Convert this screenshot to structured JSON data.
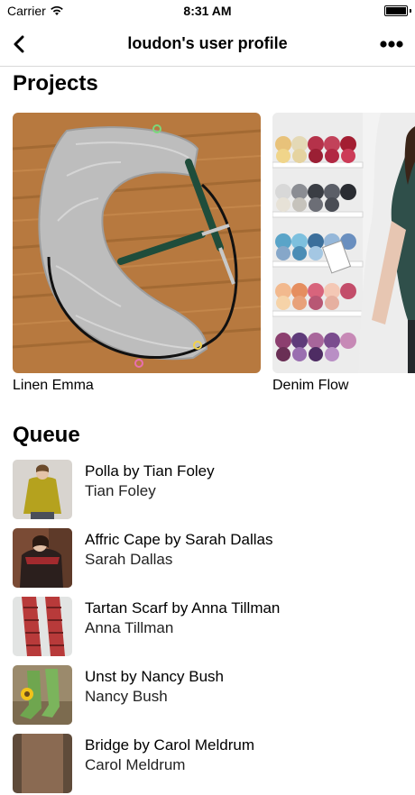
{
  "status": {
    "carrier": "Carrier",
    "time": "8:31 AM"
  },
  "nav": {
    "title": "loudon's user profile",
    "back_icon": "chevron-left-icon",
    "more_icon": "ellipsis-icon"
  },
  "projects": {
    "heading": "Projects",
    "items": [
      {
        "name": "Linen Emma"
      },
      {
        "name": "Denim Flow"
      }
    ]
  },
  "queue": {
    "heading": "Queue",
    "items": [
      {
        "title": "Polla by Tian Foley",
        "author": "Tian Foley"
      },
      {
        "title": "Affric Cape by Sarah Dallas",
        "author": "Sarah Dallas"
      },
      {
        "title": "Tartan Scarf by Anna Tillman",
        "author": "Anna Tillman"
      },
      {
        "title": "Unst by Nancy Bush",
        "author": "Nancy Bush"
      },
      {
        "title": "Bridge by Carol Meldrum",
        "author": "Carol Meldrum"
      }
    ]
  },
  "colors": {
    "divider": "#d8d8d8",
    "wood": "#b7793f",
    "yarn_grey": "#bdbdbd",
    "shelf_white": "#f3f3f3"
  }
}
